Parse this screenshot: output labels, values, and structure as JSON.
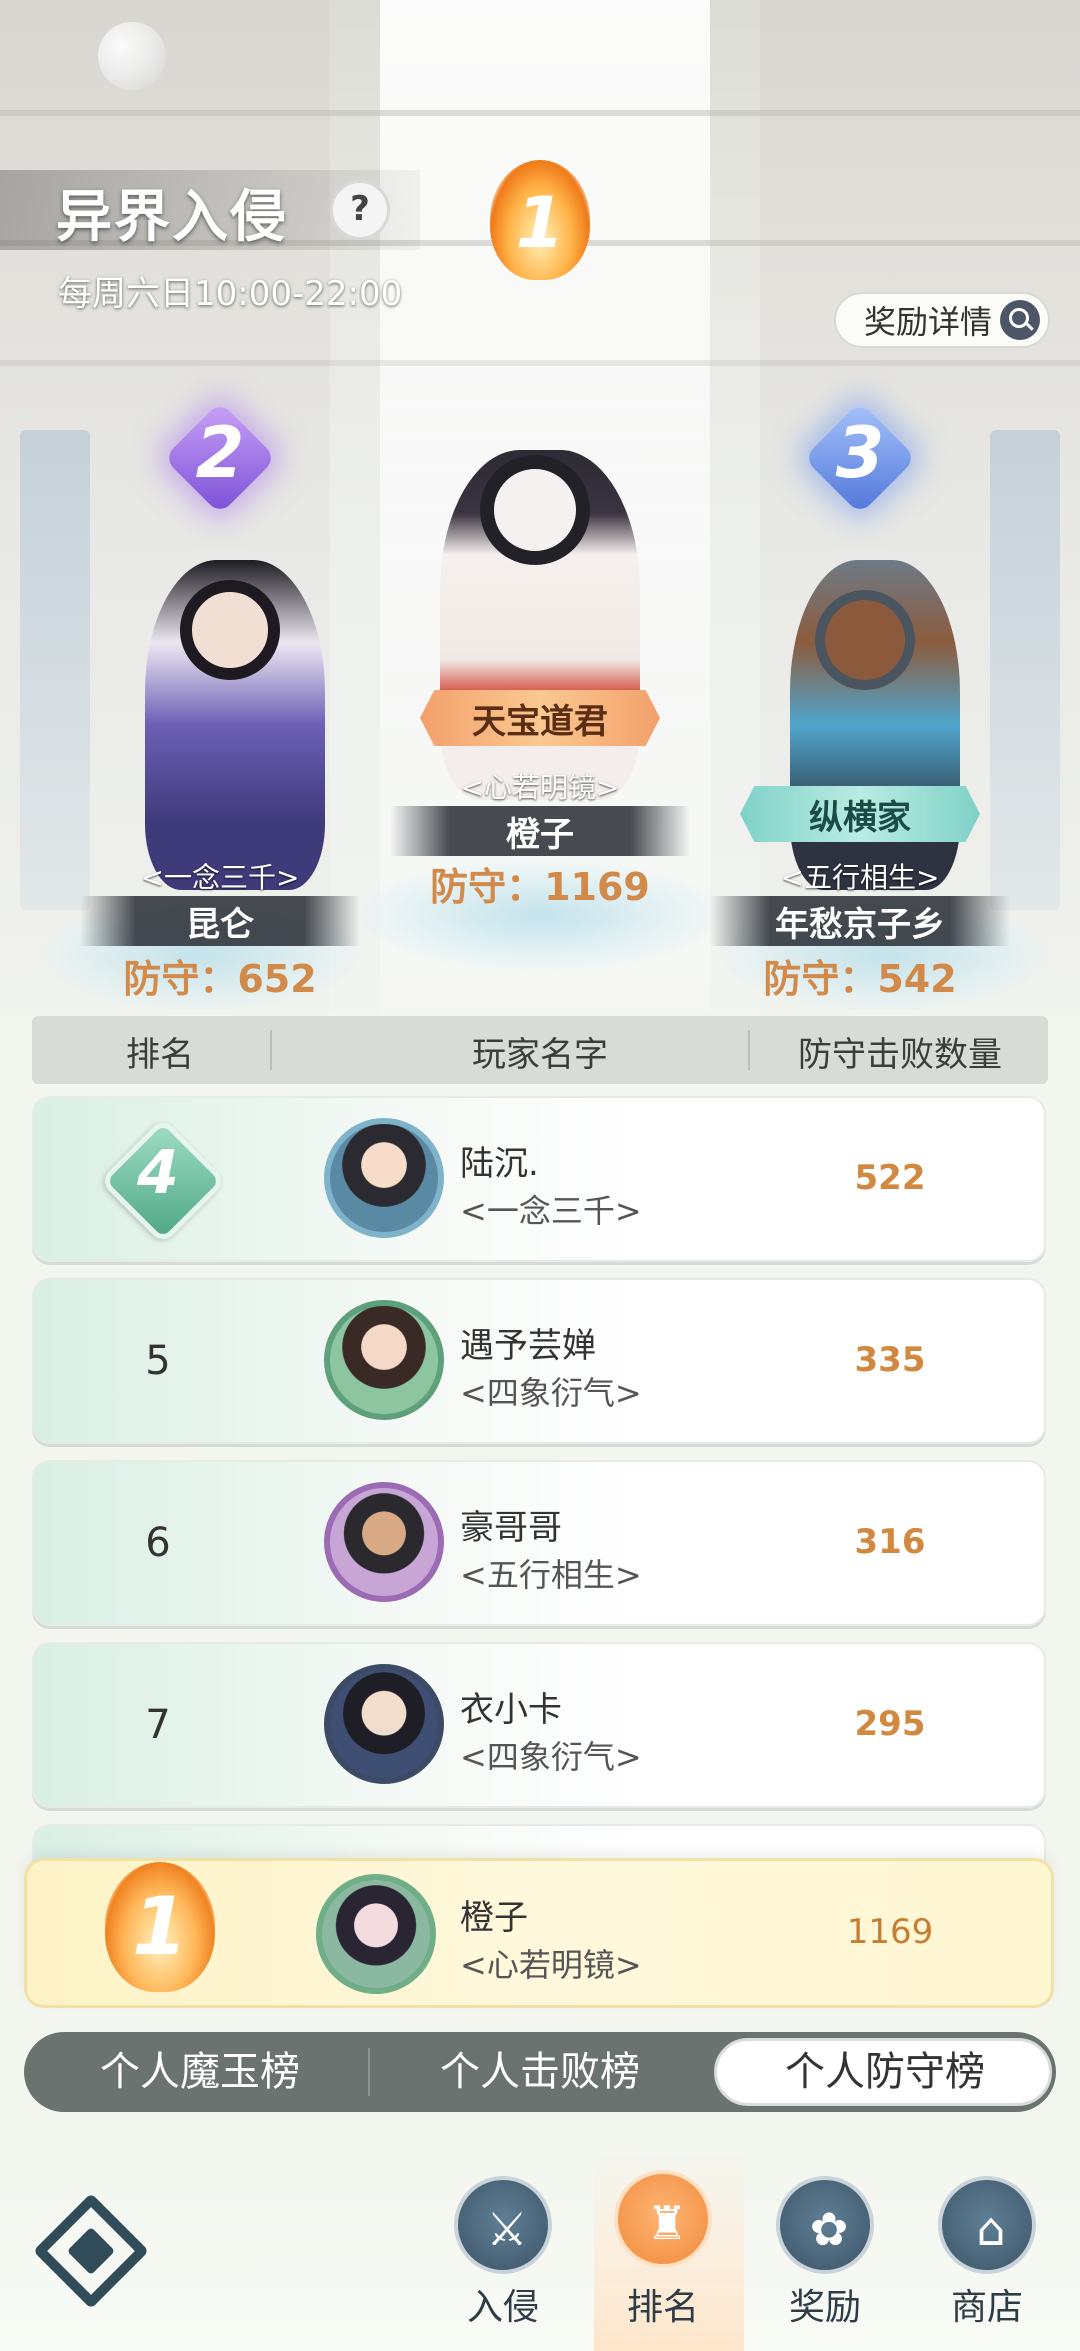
{
  "header": {
    "title": "异界入侵",
    "help_icon": "?",
    "schedule": "每周六日10:00-22:00",
    "reward_detail_label": "奖励详情"
  },
  "podium": [
    {
      "rank": "1",
      "title": "天宝道君",
      "guild": "<心若明镜>",
      "name": "橙子",
      "defense_label": "防守：1169"
    },
    {
      "rank": "2",
      "title": "",
      "guild": "<一念三千>",
      "name": "昆仑",
      "defense_label": "防守：652"
    },
    {
      "rank": "3",
      "title": "纵横家",
      "guild": "<五行相生>",
      "name": "年愁京子乡",
      "defense_label": "防守：542"
    }
  ],
  "table": {
    "headers": [
      "排名",
      "玩家名字",
      "防守击败数量"
    ],
    "rows": [
      {
        "rank": "4",
        "name": "陆沉.",
        "guild": "<一念三千>",
        "value": "522"
      },
      {
        "rank": "5",
        "name": "遇予芸婵",
        "guild": "<四象衍气>",
        "value": "335"
      },
      {
        "rank": "6",
        "name": "豪哥哥",
        "guild": "<五行相生>",
        "value": "316"
      },
      {
        "rank": "7",
        "name": "衣小卡",
        "guild": "<四象衍气>",
        "value": "295"
      }
    ]
  },
  "self_entry": {
    "rank": "1",
    "name": "橙子",
    "guild": "<心若明镜>",
    "value": "1169"
  },
  "tabs": {
    "items": [
      "个人魔玉榜",
      "个人击败榜",
      "个人防守榜"
    ],
    "active": "个人防守榜"
  },
  "nav": {
    "items": [
      {
        "label": "入侵",
        "icon": "swords-icon"
      },
      {
        "label": "排名",
        "icon": "ranking-icon"
      },
      {
        "label": "奖励",
        "icon": "reward-icon"
      },
      {
        "label": "商店",
        "icon": "shop-icon"
      }
    ],
    "active": "排名"
  },
  "colors": {
    "accent_orange": "#d28a4a",
    "tab_bar": "#6b7370",
    "nav_icon": "#3d5567"
  }
}
